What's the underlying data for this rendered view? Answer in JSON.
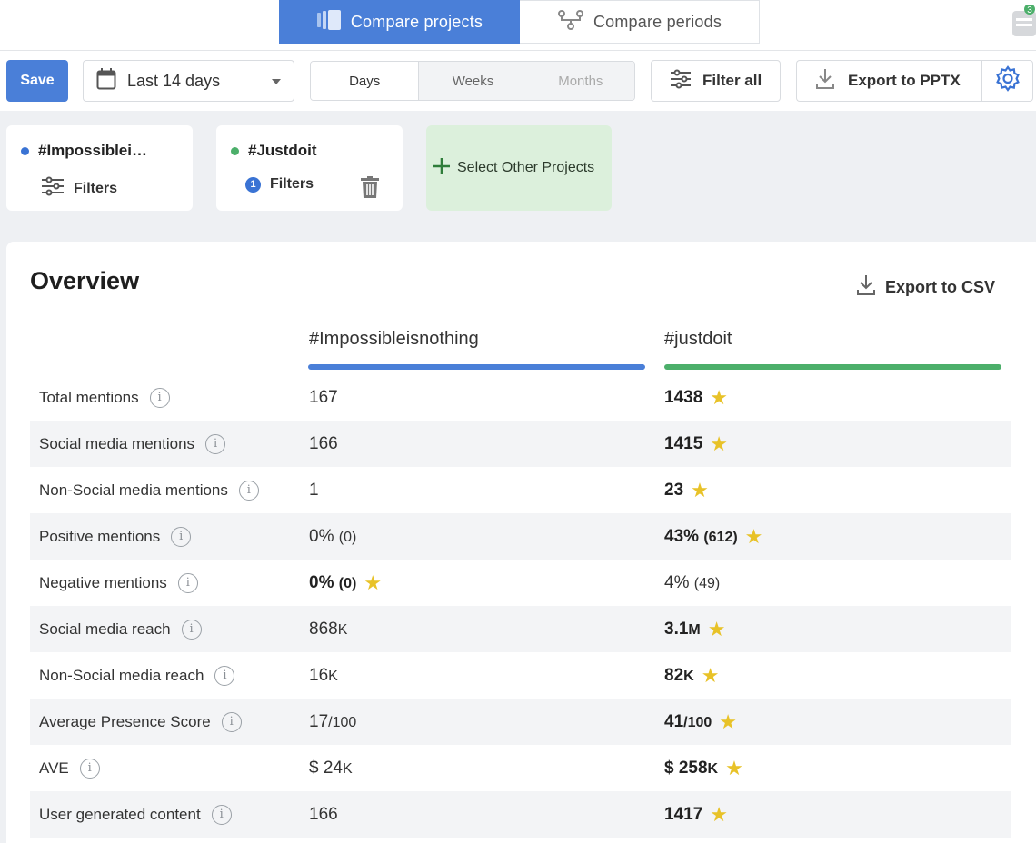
{
  "mode_tabs": {
    "compare_projects": "Compare projects",
    "compare_periods": "Compare periods"
  },
  "notifications": {
    "count": "3"
  },
  "toolbar": {
    "save_label": "Save",
    "date_range": "Last 14 days",
    "granularity": [
      "Days",
      "Weeks",
      "Months"
    ],
    "filter_all_label": "Filter all",
    "export_pptx_label": "Export to PPTX"
  },
  "projects": [
    {
      "name": "#Impossiblei…",
      "dot_color": "#3a73d4",
      "filters_label": "Filters",
      "filter_count": ""
    },
    {
      "name": "#Justdoit",
      "dot_color": "#4caf6a",
      "filters_label": "Filters",
      "filter_count": "1"
    }
  ],
  "select_other_label": "Select Other Projects",
  "overview": {
    "title": "Overview",
    "export_csv_label": "Export to CSV",
    "columns": [
      {
        "name": "#Impossibleisnothing",
        "color": "#4a7fd8"
      },
      {
        "name": "#justdoit",
        "color": "#4caf6a"
      }
    ],
    "rows": [
      {
        "label": "Total mentions",
        "v1": "167",
        "v1_sub": "",
        "v2": "1438",
        "v2_sub": "",
        "winner": 2
      },
      {
        "label": "Social media mentions",
        "v1": "166",
        "v1_sub": "",
        "v2": "1415",
        "v2_sub": "",
        "winner": 2
      },
      {
        "label": "Non-Social media mentions",
        "v1": "1",
        "v1_sub": "",
        "v2": "23",
        "v2_sub": "",
        "winner": 2
      },
      {
        "label": "Positive mentions",
        "v1": "0%",
        "v1_sub": "(0)",
        "v2": "43%",
        "v2_sub": "(612)",
        "winner": 2
      },
      {
        "label": "Negative mentions",
        "v1": "0%",
        "v1_sub": "(0)",
        "v2": "4%",
        "v2_sub": "(49)",
        "winner": 1
      },
      {
        "label": "Social media reach",
        "v1": "868",
        "v1_sub": "K",
        "v2": "3.1",
        "v2_sub": "M",
        "winner": 2
      },
      {
        "label": "Non-Social media reach",
        "v1": "16",
        "v1_sub": "K",
        "v2": "82",
        "v2_sub": "K",
        "winner": 2
      },
      {
        "label": "Average Presence Score",
        "v1": "17",
        "v1_sub": "/100",
        "v2": "41",
        "v2_sub": "/100",
        "winner": 2
      },
      {
        "label": "AVE",
        "v1": "$ 24",
        "v1_sub": "K",
        "v2": "$ 258",
        "v2_sub": "K",
        "winner": 2
      },
      {
        "label": "User generated content",
        "v1": "166",
        "v1_sub": "",
        "v2": "1417",
        "v2_sub": "",
        "winner": 2
      }
    ]
  }
}
